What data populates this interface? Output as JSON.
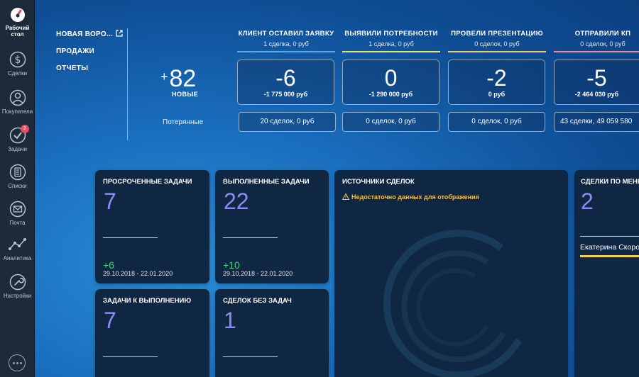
{
  "sidebar": {
    "items": [
      {
        "label": "Рабочий стол",
        "icon": "dashboard-gauge-icon",
        "active": true
      },
      {
        "label": "Сделки",
        "icon": "dollar-icon"
      },
      {
        "label": "Покупатели",
        "icon": "customers-icon"
      },
      {
        "label": "Задачи",
        "icon": "tasks-check-icon",
        "badge": "2"
      },
      {
        "label": "Списки",
        "icon": "lists-icon"
      },
      {
        "label": "Почта",
        "icon": "mail-icon"
      },
      {
        "label": "Аналитика",
        "icon": "analytics-icon"
      },
      {
        "label": "Настройки",
        "icon": "settings-wrench-icon"
      }
    ],
    "chat_icon": "chat-bubble-icon"
  },
  "menu": {
    "pipeline": "НОВАЯ ВОРО...",
    "sales": "ПРОДАЖИ",
    "reports": "ОТЧЕТЫ"
  },
  "summary": {
    "new_value": "82",
    "new_sign": "+",
    "new_label": "НОВЫЕ",
    "lost_label": "Потерянные"
  },
  "stages": [
    {
      "name": "КЛИЕНТ ОСТАВИЛ ЗАЯВКУ",
      "sub": "1 сделка, 0 руб",
      "color": "#5fa8e8",
      "sign": "-",
      "value": "6",
      "sum": "-1 775 000 руб",
      "lost": "20 сделок, 0 руб"
    },
    {
      "name": "ВЫЯВИЛИ ПОТРЕБНОСТИ",
      "sub": "1 сделка, 0 руб",
      "color": "#e3e86a",
      "sign": "",
      "value": "0",
      "sum": "-1 290 000 руб",
      "lost": "0 сделок, 0 руб"
    },
    {
      "name": "ПРОВЕЛИ ПРЕЗЕНТАЦИЮ",
      "sub": "0 сделок, 0 руб",
      "color": "#f2c86a",
      "sign": "-",
      "value": "2",
      "sum": "0 руб",
      "lost": "0 сделок, 0 руб"
    },
    {
      "name": "ОТПРАВИЛИ КП",
      "sub": "0 сделок, 0 руб",
      "color": "#f2879e",
      "sign": "-",
      "value": "5",
      "sum": "-2 464 030 руб",
      "lost": "43 сделки, 49 059 580"
    }
  ],
  "cards": {
    "overdue": {
      "title": "ПРОСРОЧЕННЫЕ ЗАДАЧИ",
      "value": "7",
      "delta": "+6",
      "range": "29.10.2018 - 22.01.2020"
    },
    "done": {
      "title": "ВЫПОЛНЕННЫЕ ЗАДАЧИ",
      "value": "22",
      "delta": "+10",
      "range": "29.10.2018 - 22.01.2020"
    },
    "sources": {
      "title": "ИСТОЧНИКИ СДЕЛОК",
      "warning": "Недостаточно данных для отображения"
    },
    "managers": {
      "title": "СДЕЛКИ ПО МЕНЕ",
      "value": "2",
      "manager": "Екатерина Скоро"
    },
    "todo": {
      "title": "ЗАДАЧИ К ВЫПОЛНЕНИЮ",
      "value": "7"
    },
    "no_tasks": {
      "title": "СДЕЛОК БЕЗ ЗАДАЧ",
      "value": "1"
    }
  }
}
